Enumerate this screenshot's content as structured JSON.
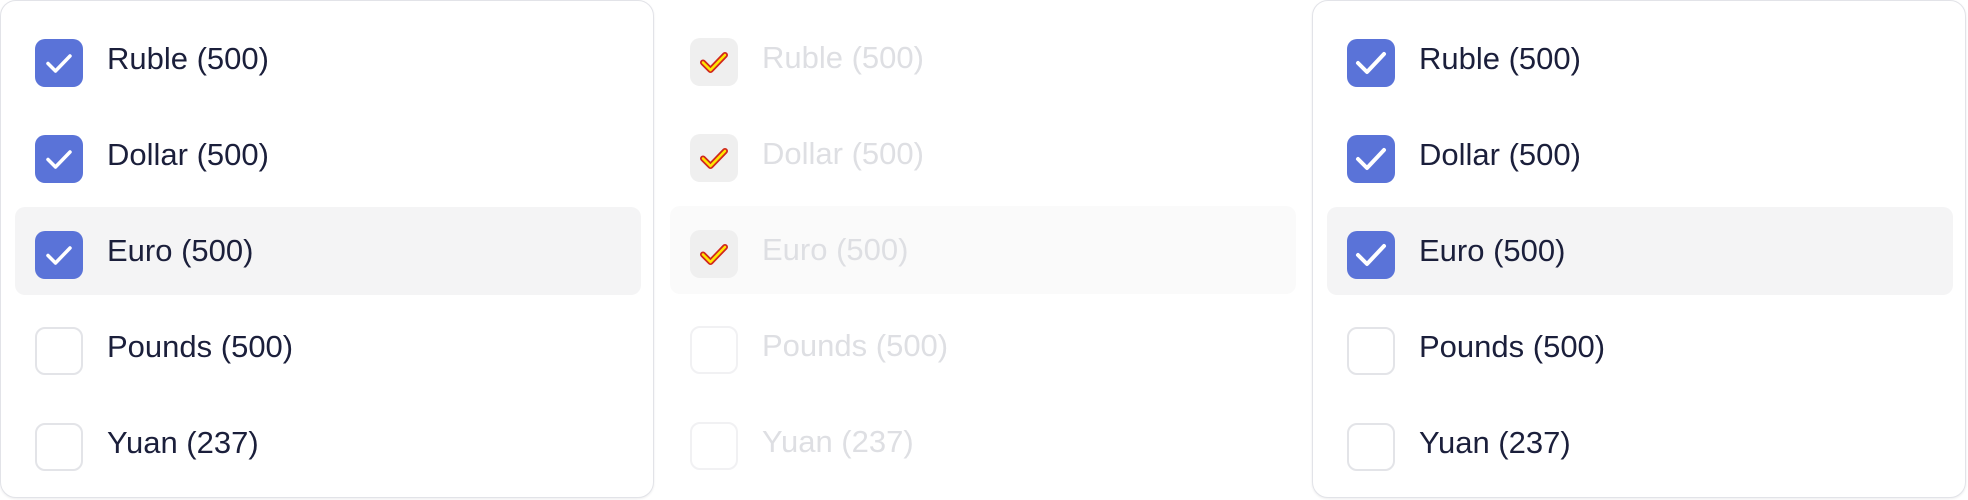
{
  "colors": {
    "accent": "#5a73d8",
    "text": "#1b1f3b",
    "disabled_text": "#dedfe3",
    "hover_row": "#f4f4f5"
  },
  "panels": [
    {
      "state": "default",
      "items": [
        {
          "label": "Ruble (500)",
          "checked": true
        },
        {
          "label": "Dollar (500)",
          "checked": true
        },
        {
          "label": "Euro (500)",
          "checked": true,
          "highlighted": true
        },
        {
          "label": "Pounds (500)",
          "checked": false
        },
        {
          "label": "Yuan (237)",
          "checked": false
        }
      ]
    },
    {
      "state": "disabled",
      "items": [
        {
          "label": "Ruble (500)",
          "checked": true
        },
        {
          "label": "Dollar (500)",
          "checked": true
        },
        {
          "label": "Euro (500)",
          "checked": true,
          "highlighted": true
        },
        {
          "label": "Pounds (500)",
          "checked": false
        },
        {
          "label": "Yuan (237)",
          "checked": false
        }
      ]
    },
    {
      "state": "default",
      "items": [
        {
          "label": "Ruble (500)",
          "checked": true
        },
        {
          "label": "Dollar (500)",
          "checked": true
        },
        {
          "label": "Euro (500)",
          "checked": true,
          "highlighted": true
        },
        {
          "label": "Pounds (500)",
          "checked": false
        },
        {
          "label": "Yuan (237)",
          "checked": false
        }
      ]
    }
  ]
}
